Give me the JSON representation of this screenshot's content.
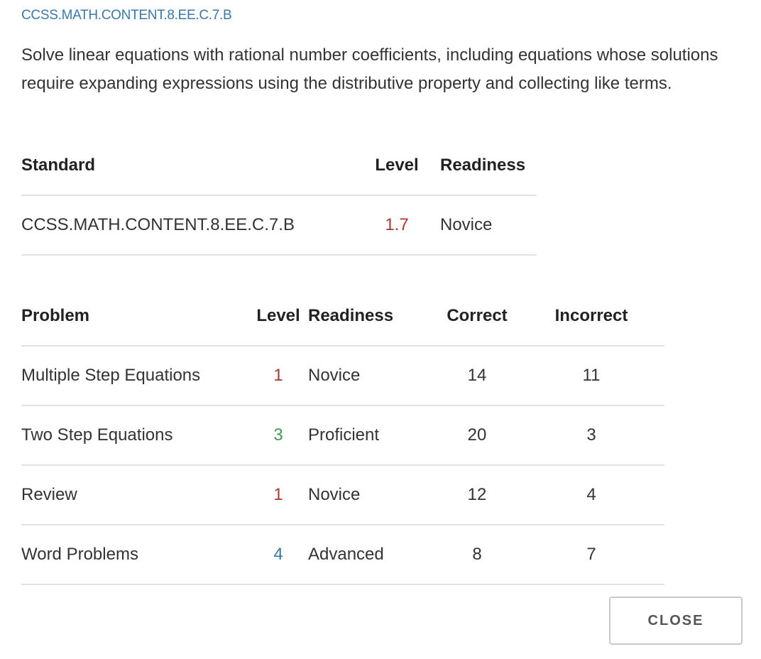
{
  "standard_code_link": "CCSS.MATH.CONTENT.8.EE.C.7.B",
  "description": "Solve linear equations with rational number coefficients, including equations whose solutions require expanding expressions using the distributive property and collecting like terms.",
  "standard_table": {
    "headers": {
      "standard": "Standard",
      "level": "Level",
      "readiness": "Readiness"
    },
    "row": {
      "standard": "CCSS.MATH.CONTENT.8.EE.C.7.B",
      "level": "1.7",
      "readiness": "Novice"
    }
  },
  "problem_table": {
    "headers": {
      "problem": "Problem",
      "level": "Level",
      "readiness": "Readiness",
      "correct": "Correct",
      "incorrect": "Incorrect"
    },
    "rows": [
      {
        "problem": "Multiple Step Equations",
        "level": "1",
        "readiness": "Novice",
        "correct": "14",
        "incorrect": "11"
      },
      {
        "problem": "Two Step Equations",
        "level": "3",
        "readiness": "Proficient",
        "correct": "20",
        "incorrect": "3"
      },
      {
        "problem": "Review",
        "level": "1",
        "readiness": "Novice",
        "correct": "12",
        "incorrect": "4"
      },
      {
        "problem": "Word Problems",
        "level": "4",
        "readiness": "Advanced",
        "correct": "8",
        "incorrect": "7"
      }
    ]
  },
  "close_button": {
    "label": "CLOSE"
  },
  "colors": {
    "link": "#3a78ac",
    "novice": "#a83a32",
    "proficient": "#3e9a52",
    "advanced": "#3a78ac"
  }
}
